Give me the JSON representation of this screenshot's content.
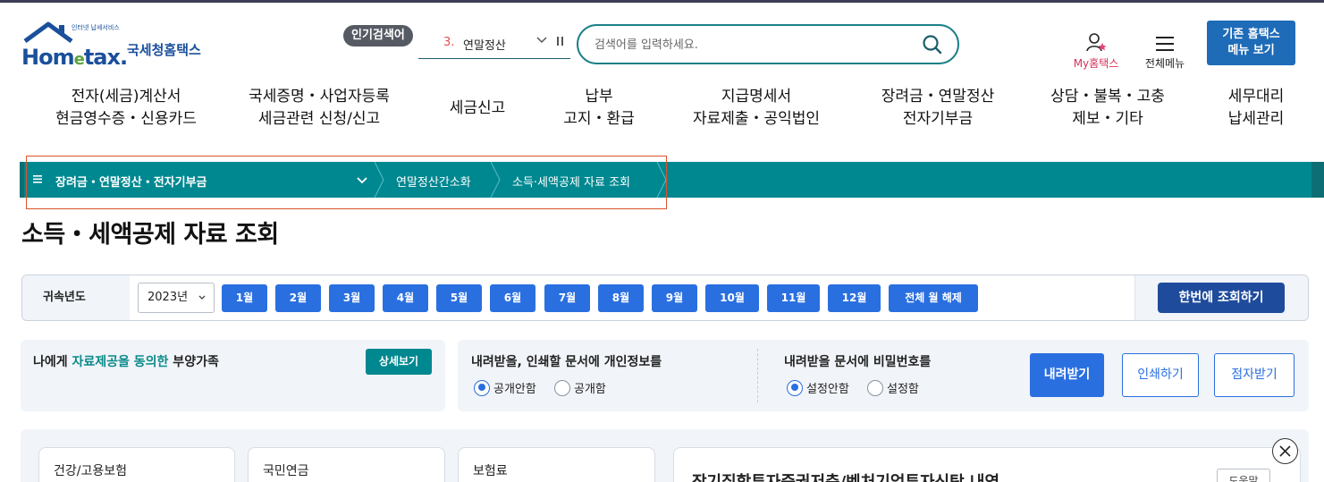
{
  "header": {
    "logo_text": "Hometax.",
    "logo_sub": "인터넷 납세서비스",
    "logo_kor": "국세청홈택스",
    "popular_badge": "인기검색어",
    "popular_rank": "3.",
    "popular_term": "연말정산",
    "search_placeholder": "검색어를 입력하세요.",
    "my_hometax": "My홈택스",
    "all_menu": "전체메뉴",
    "old_hometax_line1": "기존 홈택스",
    "old_hometax_line2": "메뉴 보기"
  },
  "gnb": [
    {
      "l1": "전자(세금)계산서",
      "l2": "현금영수증・신용카드"
    },
    {
      "l1": "국세증명・사업자등록",
      "l2": "세금관련 신청/신고"
    },
    {
      "l1": "세금신고",
      "l2": ""
    },
    {
      "l1": "납부",
      "l2": "고지・환급"
    },
    {
      "l1": "지급명세서",
      "l2": "자료제출・공익법인"
    },
    {
      "l1": "장려금・연말정산",
      "l2": "전자기부금"
    },
    {
      "l1": "상담・불복・고충",
      "l2": "제보・기타"
    },
    {
      "l1": "세무대리",
      "l2": "납세관리"
    }
  ],
  "breadcrumb": {
    "root": "장려금・연말정산・전자기부금",
    "level2": "연말정산간소화",
    "level3": "소득·세액공제 자료 조회"
  },
  "page_title": "소득・세액공제 자료 조회",
  "year_bar": {
    "label": "귀속년도",
    "year_value": "2023년",
    "months": [
      "1월",
      "2월",
      "3월",
      "4월",
      "5월",
      "6월",
      "7월",
      "8월",
      "9월",
      "10월",
      "11월",
      "12월"
    ],
    "clear_all": "전체 월 해제",
    "query_once": "한번에 조회하기"
  },
  "dependents_panel": {
    "prefix": "나에게 ",
    "highlight": "자료제공을 동의한",
    "suffix": " 부양가족",
    "detail_button": "상세보기"
  },
  "download_panel": {
    "privacy_title": "내려받을, 인쇄할 문서에 개인정보를",
    "privacy_opt1": "공개안함",
    "privacy_opt2": "공개함",
    "password_title": "내려받을 문서에 비밀번호를",
    "password_opt1": "설정안함",
    "password_opt2": "설정함",
    "download": "내려받기",
    "print": "인쇄하기",
    "braille": "점자받기"
  },
  "cards": [
    "건강/고용보험",
    "국민연금",
    "보험료"
  ],
  "detail_card": {
    "title": "장기집합투자증권저축/벤처기업투자신탁 내역",
    "help": "도움말"
  },
  "colors": {
    "teal": "#008891",
    "blue": "#2a6fe0",
    "navy": "#1f4b9c",
    "brand": "#1a4f9c"
  }
}
